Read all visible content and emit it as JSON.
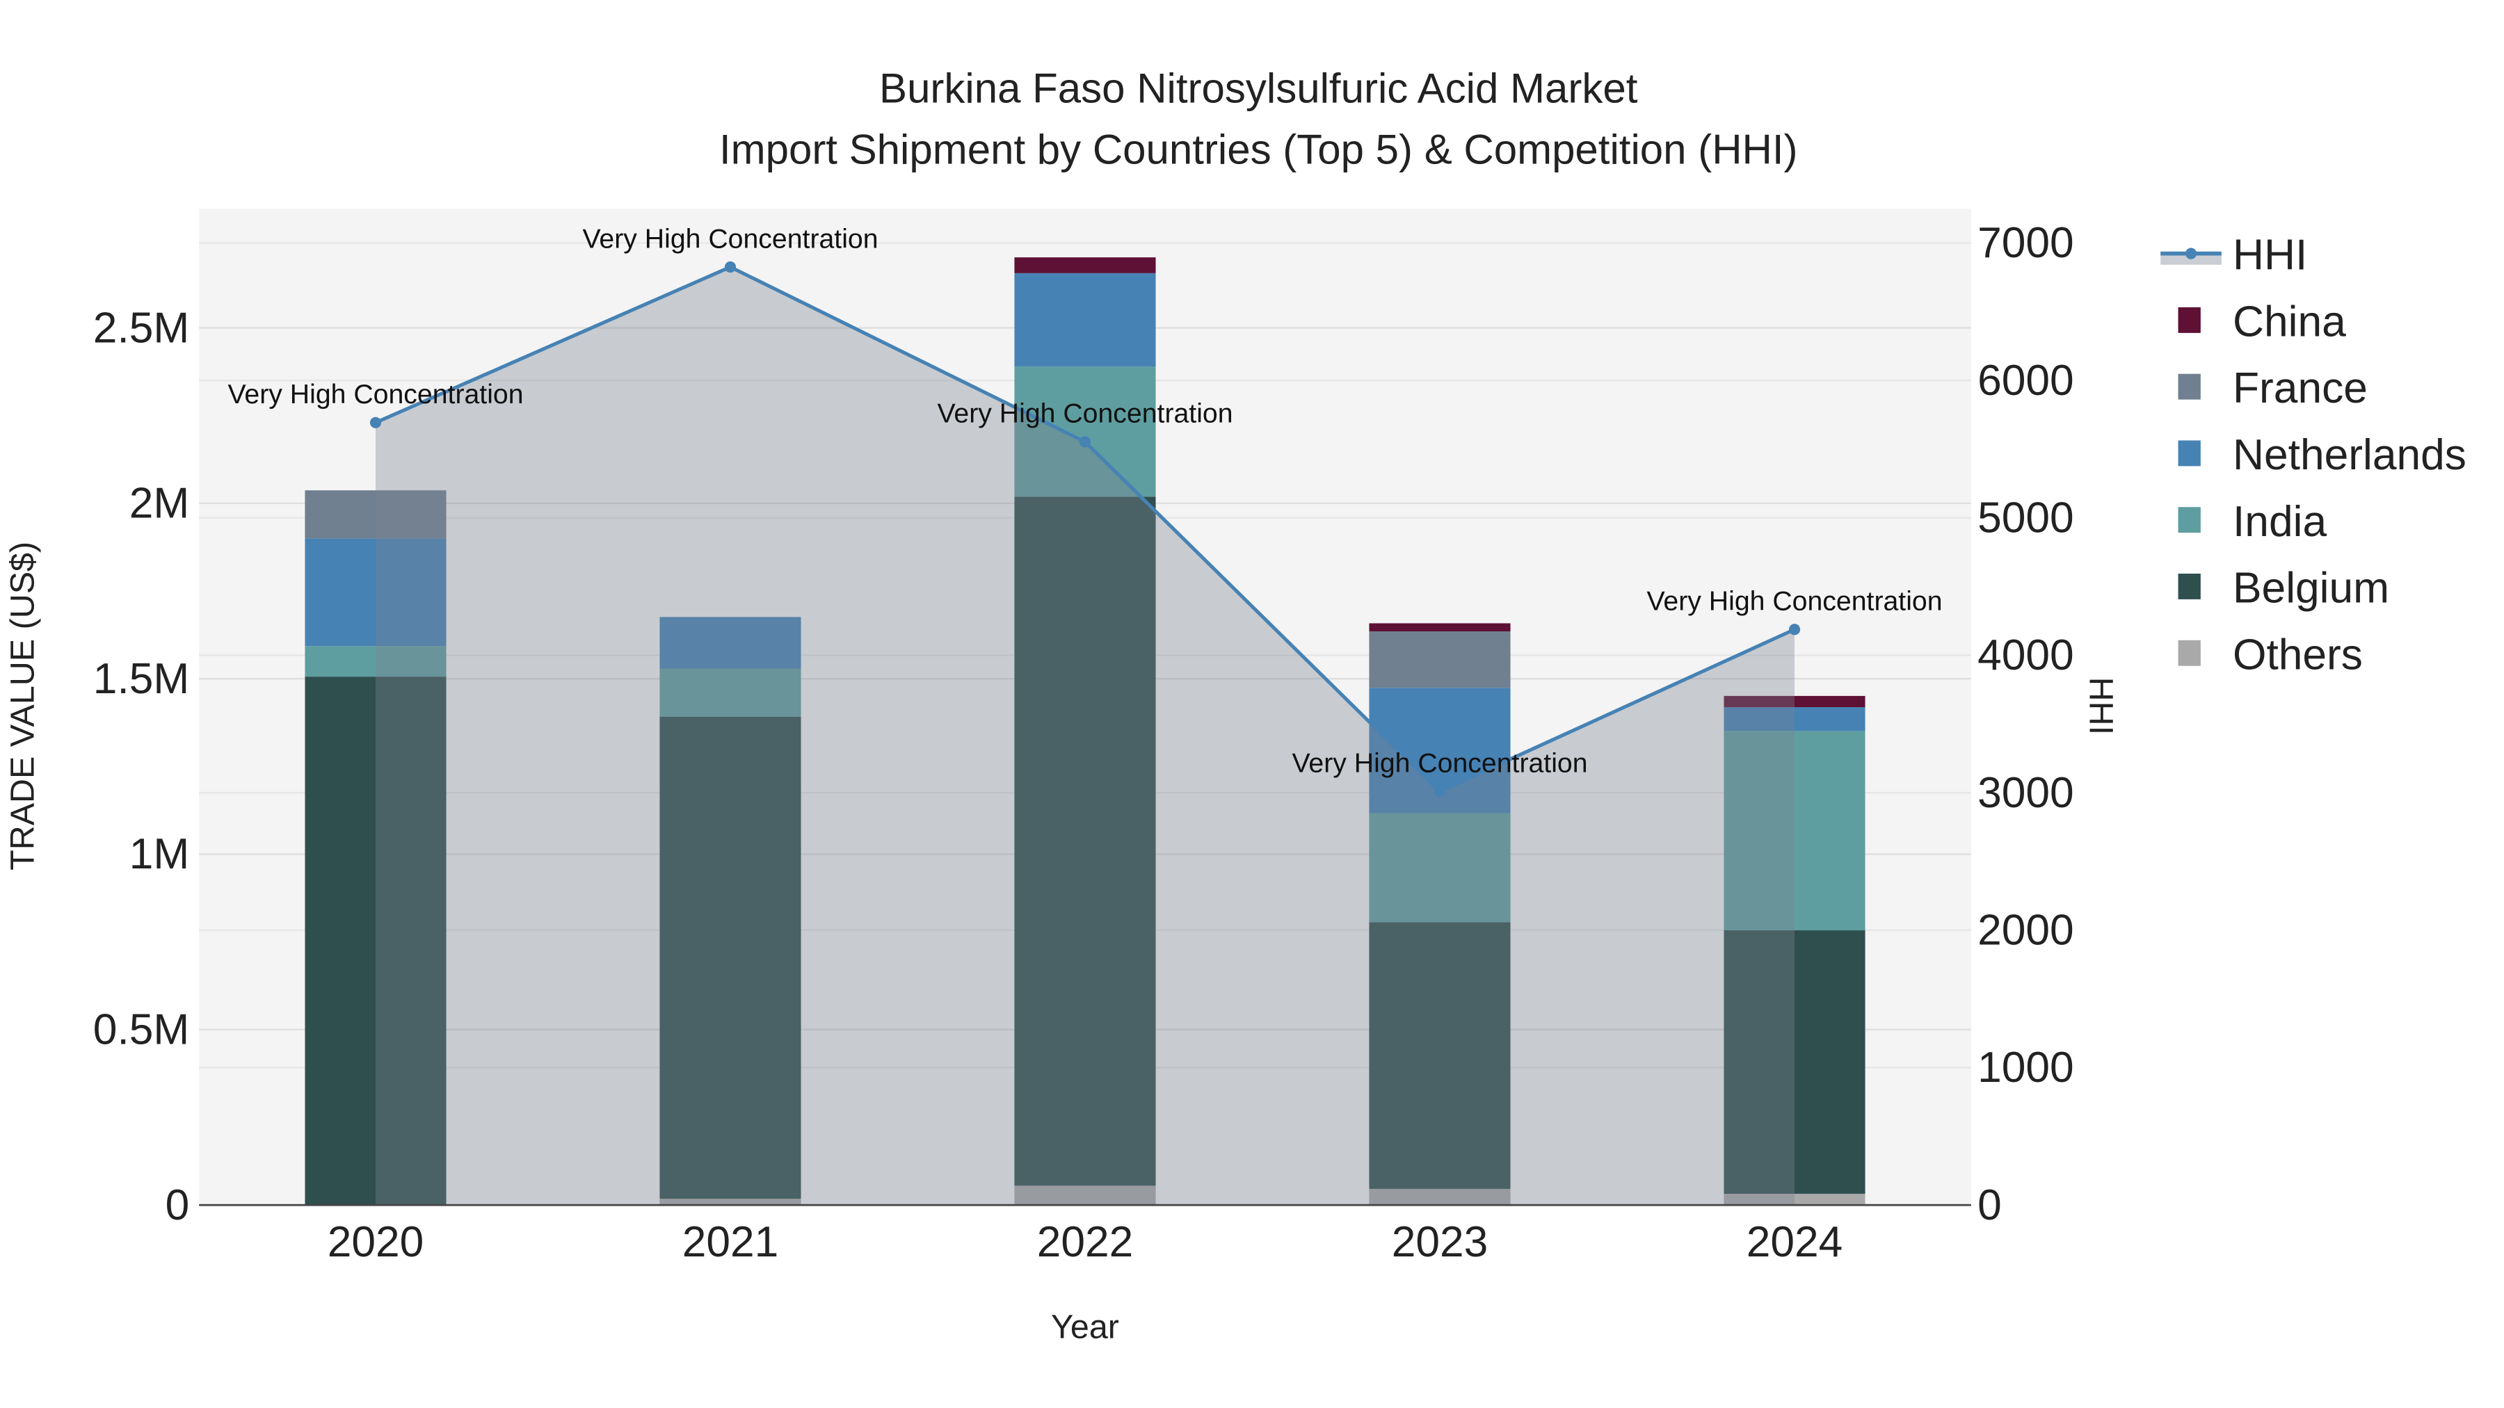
{
  "chart_data": {
    "type": "bar",
    "title": "Burkina Faso Nitrosylsulfuric Acid Market",
    "subtitle": "Import Shipment by Countries (Top 5) & Competition (HHI)",
    "xlabel": "Year",
    "ylabel": "TRADE VALUE (US$)",
    "y2label": "HHI",
    "categories": [
      "2020",
      "2021",
      "2022",
      "2023",
      "2024"
    ],
    "stacked": true,
    "ylim": [
      0,
      2840000
    ],
    "y2lim": [
      0,
      7250
    ],
    "yticks": [
      {
        "v": 0,
        "label": "0"
      },
      {
        "v": 500000,
        "label": "0.5M"
      },
      {
        "v": 1000000,
        "label": "1M"
      },
      {
        "v": 1500000,
        "label": "1.5M"
      },
      {
        "v": 2000000,
        "label": "2M"
      },
      {
        "v": 2500000,
        "label": "2.5M"
      }
    ],
    "y2ticks": [
      {
        "v": 0,
        "label": "0"
      },
      {
        "v": 1000,
        "label": "1000"
      },
      {
        "v": 2000,
        "label": "2000"
      },
      {
        "v": 3000,
        "label": "3000"
      },
      {
        "v": 4000,
        "label": "4000"
      },
      {
        "v": 5000,
        "label": "5000"
      },
      {
        "v": 6000,
        "label": "6000"
      },
      {
        "v": 7000,
        "label": "7000"
      }
    ],
    "series": [
      {
        "name": "Others",
        "color": "#A9A9A9",
        "values": [
          0,
          18000,
          55000,
          46000,
          32000
        ]
      },
      {
        "name": "Belgium",
        "color": "#2F4F4F",
        "values": [
          1506000,
          1374000,
          1964000,
          760000,
          751000
        ]
      },
      {
        "name": "India",
        "color": "#5F9EA0",
        "values": [
          87000,
          137000,
          371000,
          311000,
          568000
        ]
      },
      {
        "name": "Netherlands",
        "color": "#4682B4",
        "values": [
          307000,
          147000,
          266000,
          357000,
          68000
        ]
      },
      {
        "name": "France",
        "color": "#708090",
        "values": [
          137000,
          0,
          0,
          161000,
          0
        ]
      },
      {
        "name": "China",
        "color": "#5E1035",
        "values": [
          0,
          0,
          45000,
          23000,
          32000
        ]
      }
    ],
    "hhi": {
      "name": "HHI",
      "color": "#4682B4",
      "values": [
        5693,
        6825,
        5553,
        3010,
        4188
      ],
      "annotations": [
        "Very High Concentration",
        "Very High Concentration",
        "Very High Concentration",
        "Very High Concentration",
        "Very High Concentration"
      ]
    },
    "legend_order": [
      "HHI",
      "China",
      "France",
      "Netherlands",
      "India",
      "Belgium",
      "Others"
    ],
    "legend_position": "right",
    "grid": true
  }
}
